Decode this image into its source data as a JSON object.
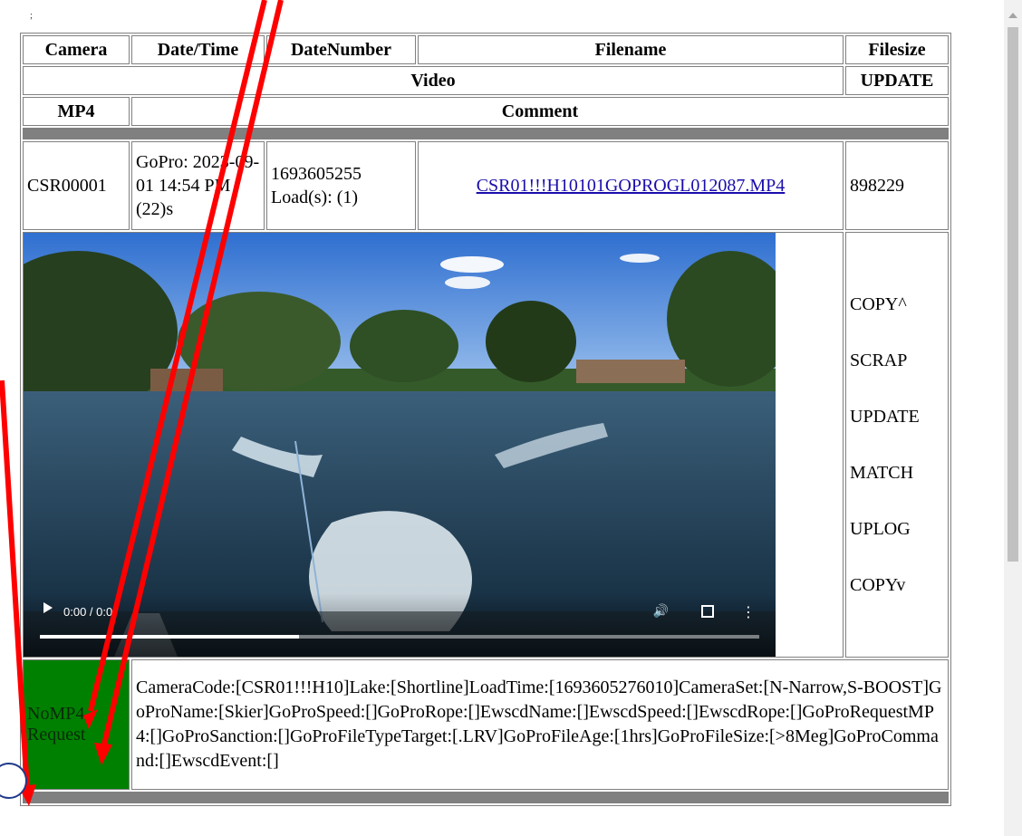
{
  "semicolon": ";",
  "headers": {
    "camera": "Camera",
    "datetime": "Date/Time",
    "datenumber": "DateNumber",
    "filename": "Filename",
    "filesize": "Filesize",
    "video": "Video",
    "update": "UPDATE",
    "mp4": "MP4",
    "comment": "Comment"
  },
  "row": {
    "camera": "CSR00001",
    "datetime": "GoPro: 2023-09-01 14:54 PM (22)s",
    "datenumber": "1693605255 Load(s): (1)",
    "filename": "CSR01!!!H10101GOPROGL012087.MP4",
    "filesize": "898229",
    "mp4_status": "NoMP4 Request",
    "comment_text": "CameraCode:[CSR01!!!H10]Lake:[Shortline]LoadTime:[1693605276010]CameraSet:[N-Narrow,S-BOOST]GoProName:[Skier]GoProSpeed:[]GoProRope:[]EwscdName:[]EwscdSpeed:[]EwscdRope:[]GoProRequestMP4:[]GoProSanction:[]GoProFileTypeTarget:[.LRV]GoProFileAge:[1hrs]GoProFileSize:[>8Meg]GoProCommand:[]EwscdEvent:[]"
  },
  "actions": [
    "COPY^",
    "SCRAP",
    "UPDATE",
    "MATCH",
    "UPLOG",
    "COPYv"
  ],
  "video": {
    "time": "0:00 / 0:0",
    "progress": 0.36
  },
  "colors": {
    "green_cell": "#008000",
    "separator": "#808080",
    "link": "#1a0dab",
    "arrow": "#ff0000"
  }
}
